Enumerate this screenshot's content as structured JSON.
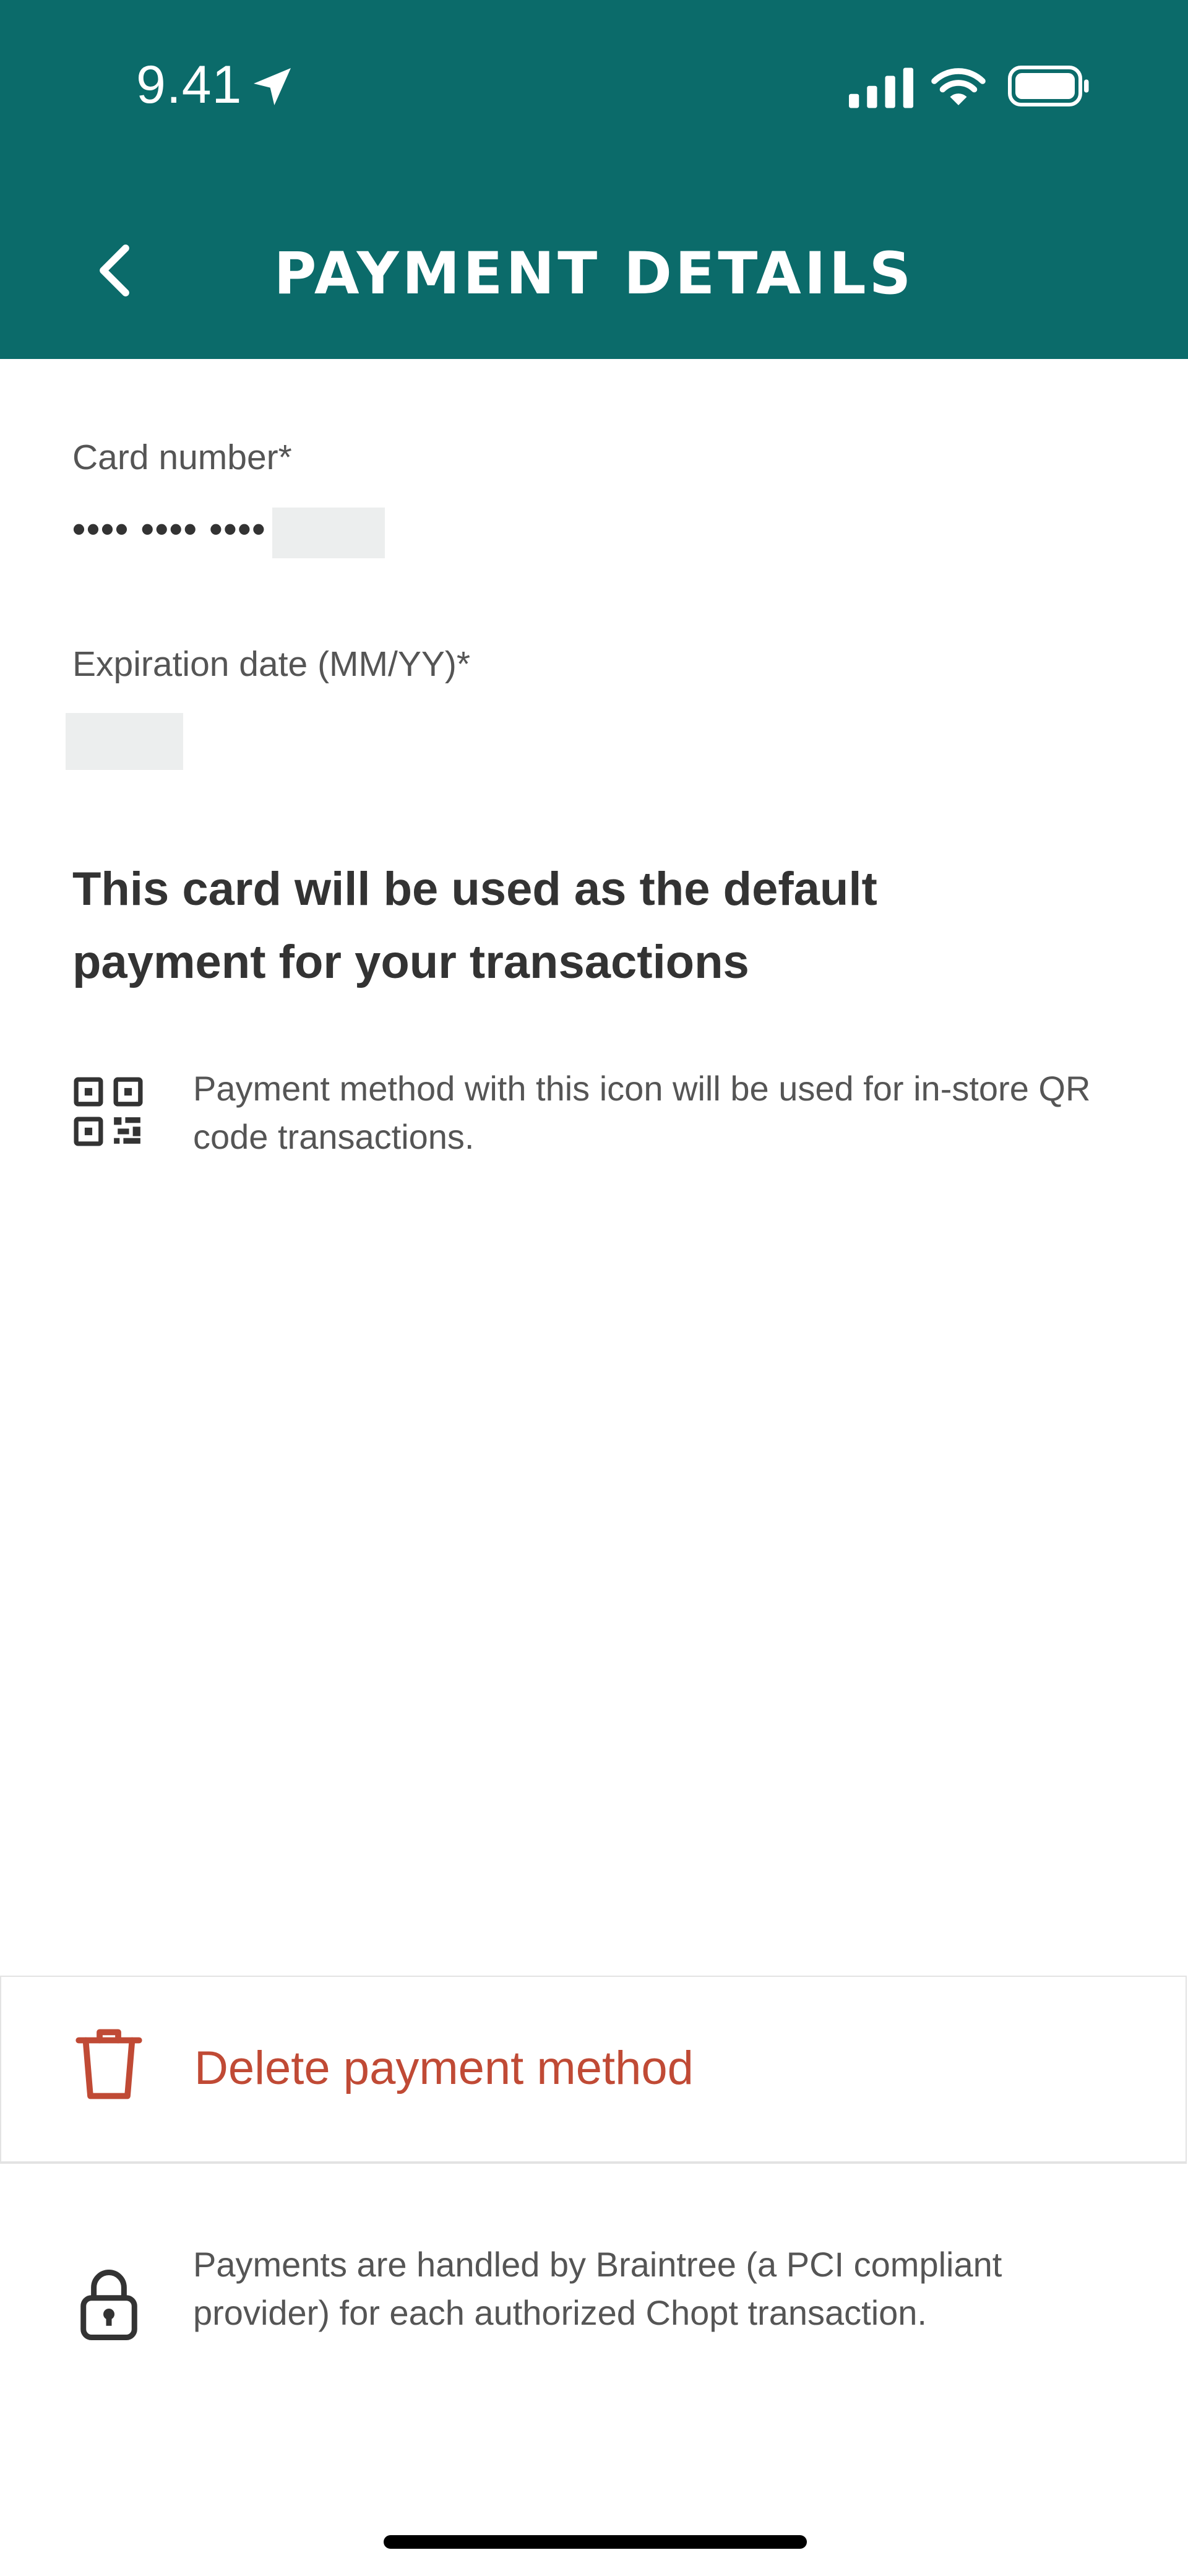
{
  "status_bar": {
    "time": "9.41",
    "icons": [
      "location-arrow-icon",
      "cellular-signal-icon",
      "wifi-icon",
      "battery-icon"
    ]
  },
  "header": {
    "title": "PAYMENT DETAILS",
    "back_icon": "chevron-left-icon",
    "background_color": "#0b6b6a"
  },
  "card_number": {
    "label": "Card number*",
    "value": "•••• •••• ••••"
  },
  "expiration": {
    "label": "Expiration date (MM/YY)*",
    "value": ""
  },
  "default_note": "This card will be used as the default payment for your transactions",
  "qr_info": {
    "icon": "qr-code-icon",
    "text": "Payment method with this icon will be used for in-store QR code transactions."
  },
  "delete": {
    "icon": "trash-icon",
    "label": "Delete payment method",
    "color": "#c04a35"
  },
  "security": {
    "icon": "lock-icon",
    "text": "Payments are handled by Braintree (a PCI compliant provider) for each authorized Chopt transaction."
  }
}
